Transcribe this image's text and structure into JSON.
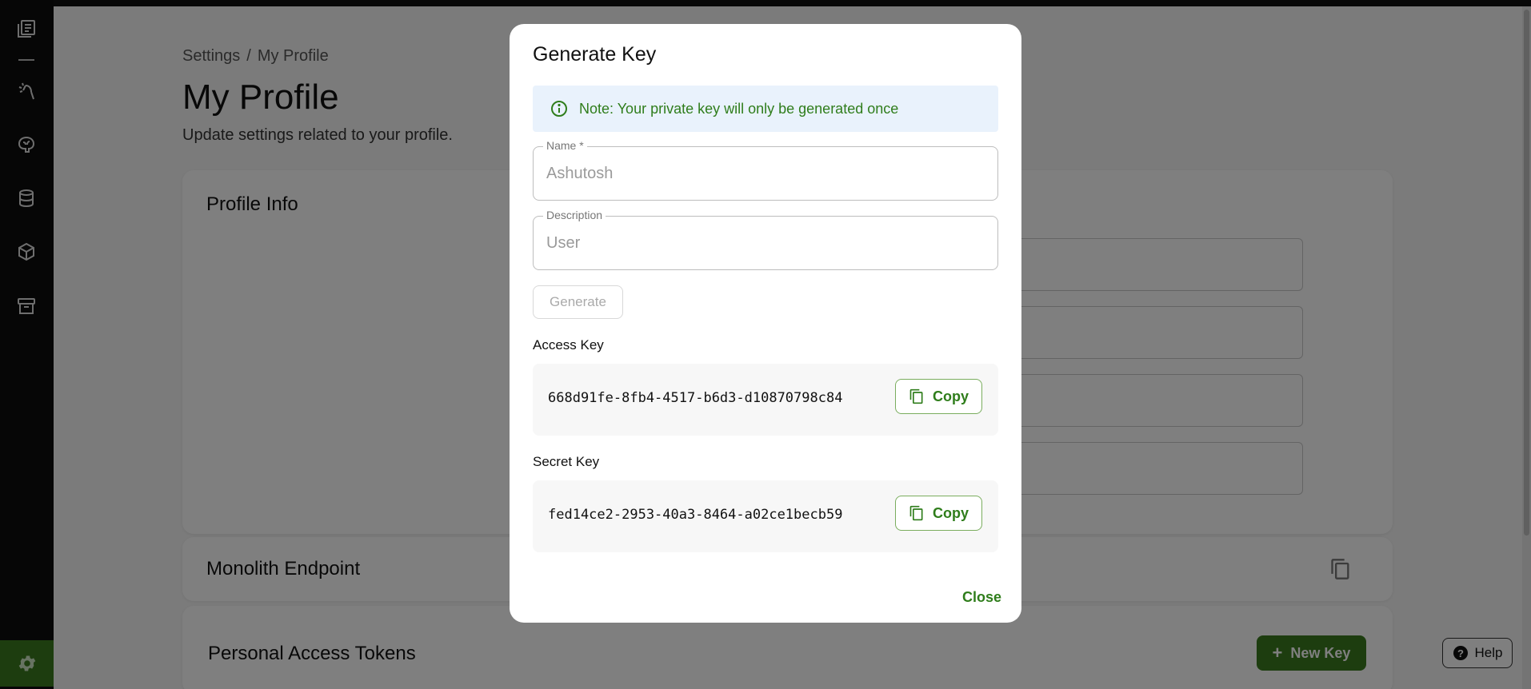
{
  "sidebar": {
    "items": [
      {
        "icon": "document-stack-icon"
      },
      {
        "icon": "magic-wand-icon"
      },
      {
        "icon": "brain-icon"
      },
      {
        "icon": "database-icon"
      },
      {
        "icon": "cube-icon"
      },
      {
        "icon": "archive-icon"
      }
    ],
    "settings_icon": "gear-icon",
    "active_color": "#3a7a1e"
  },
  "breadcrumb": {
    "root": "Settings",
    "separator": "/",
    "current": "My Profile"
  },
  "page": {
    "title": "My Profile",
    "subtitle": "Update settings related to your profile."
  },
  "cards": {
    "profile_info": {
      "title": "Profile Info"
    },
    "monolith_endpoint": {
      "title": "Monolith Endpoint"
    },
    "personal_access_tokens": {
      "title": "Personal Access Tokens",
      "new_key_label": "New Key"
    }
  },
  "help": {
    "label": "Help"
  },
  "modal": {
    "title": "Generate Key",
    "note": "Note: Your private key will only be generated once",
    "name_field": {
      "label": "Name *",
      "value": "Ashutosh"
    },
    "description_field": {
      "label": "Description",
      "value": "User"
    },
    "generate_label": "Generate",
    "access_key": {
      "label": "Access Key",
      "value": "668d91fe-8fb4-4517-b6d3-d10870798c84",
      "copy_label": "Copy"
    },
    "secret_key": {
      "label": "Secret Key",
      "value": "fed14ce2-2953-40a3-8464-a02ce1becb59",
      "copy_label": "Copy"
    },
    "close_label": "Close"
  },
  "colors": {
    "accent_green": "#2f7d1b",
    "button_green": "#3a7a1e",
    "note_bg": "#e9f2fc"
  }
}
